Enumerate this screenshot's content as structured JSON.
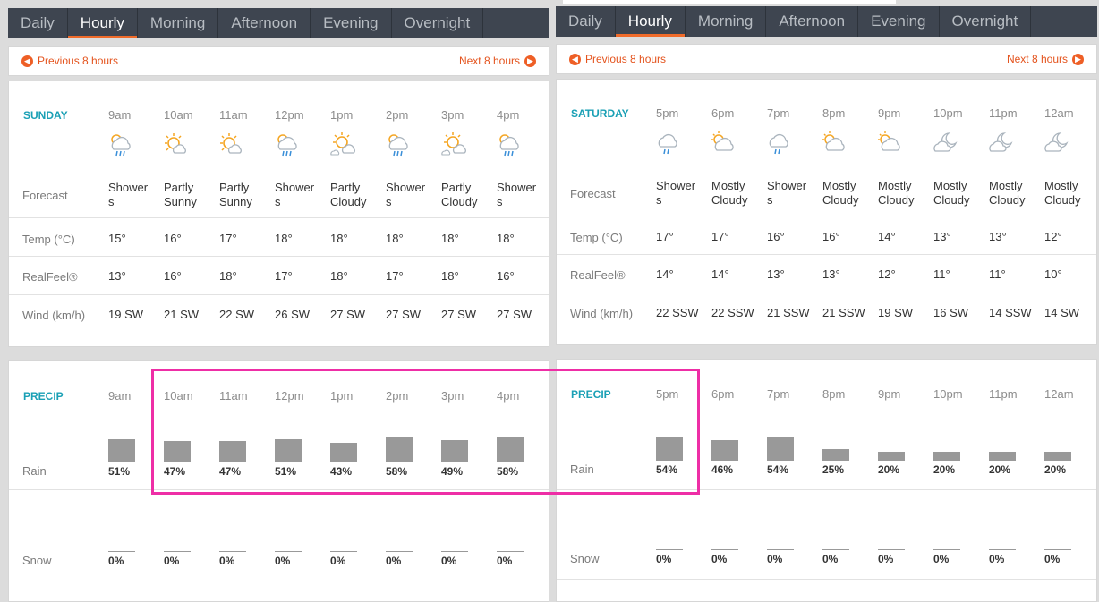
{
  "tabs": [
    "Daily",
    "Hourly",
    "Morning",
    "Afternoon",
    "Evening",
    "Overnight"
  ],
  "active_tab": "Hourly",
  "nav": {
    "prev": "Previous 8 hours",
    "next": "Next 8 hours"
  },
  "labels": {
    "forecast": "Forecast",
    "temp": "Temp (°C)",
    "realfeel": "RealFeel®",
    "wind": "Wind (km/h)",
    "precip": "PRECIP",
    "rain": "Rain",
    "snow": "Snow"
  },
  "colors": {
    "accent": "#f06b2a",
    "day_label": "#1aa0b5",
    "tab_bg": "#3e4550",
    "bar": "#999999",
    "highlight": "#ee2ea6"
  },
  "panels": [
    {
      "day": "SUNDAY",
      "hours": [
        "9am",
        "10am",
        "11am",
        "12pm",
        "1pm",
        "2pm",
        "3pm",
        "4pm"
      ],
      "icons": [
        "cloud-rain-sun-icon",
        "partly-sunny-icon",
        "partly-sunny-icon",
        "cloud-rain-sun-icon",
        "partly-cloudy-icon",
        "cloud-rain-sun-icon",
        "partly-cloudy-icon",
        "cloud-rain-sun-icon"
      ],
      "forecast_l1": [
        "Shower",
        "Partly",
        "Partly",
        "Shower",
        "Partly",
        "Shower",
        "Partly",
        "Shower"
      ],
      "forecast_l2": [
        "s",
        "Sunny",
        "Sunny",
        "s",
        "Cloudy",
        "s",
        "Cloudy",
        "s"
      ],
      "temp": [
        "15°",
        "16°",
        "17°",
        "18°",
        "18°",
        "18°",
        "18°",
        "18°"
      ],
      "realfeel": [
        "13°",
        "16°",
        "18°",
        "17°",
        "18°",
        "17°",
        "18°",
        "16°"
      ],
      "wind": [
        "19 SW",
        "21 SW",
        "22 SW",
        "26 SW",
        "27 SW",
        "27 SW",
        "27 SW",
        "27 SW"
      ],
      "rain_pct": [
        51,
        47,
        47,
        51,
        43,
        58,
        49,
        58
      ],
      "rain": [
        "51%",
        "47%",
        "47%",
        "51%",
        "43%",
        "58%",
        "49%",
        "58%"
      ],
      "snow": [
        "0%",
        "0%",
        "0%",
        "0%",
        "0%",
        "0%",
        "0%",
        "0%"
      ]
    },
    {
      "day": "SATURDAY",
      "hours": [
        "5pm",
        "6pm",
        "7pm",
        "8pm",
        "9pm",
        "10pm",
        "11pm",
        "12am"
      ],
      "icons": [
        "cloud-rain-icon",
        "mostly-cloudy-sun-icon",
        "cloud-rain-icon",
        "mostly-cloudy-sun-icon",
        "mostly-cloudy-sun-icon",
        "cloudy-moon-icon",
        "cloudy-moon-icon",
        "cloudy-moon-icon"
      ],
      "forecast_l1": [
        "Shower",
        "Mostly",
        "Shower",
        "Mostly",
        "Mostly",
        "Mostly",
        "Mostly",
        "Mostly"
      ],
      "forecast_l2": [
        "s",
        "Cloudy",
        "s",
        "Cloudy",
        "Cloudy",
        "Cloudy",
        "Cloudy",
        "Cloudy"
      ],
      "temp": [
        "17°",
        "17°",
        "16°",
        "16°",
        "14°",
        "13°",
        "13°",
        "12°"
      ],
      "realfeel": [
        "14°",
        "14°",
        "13°",
        "13°",
        "12°",
        "11°",
        "11°",
        "10°"
      ],
      "wind": [
        "22 SSW",
        "22 SSW",
        "21 SSW",
        "21 SSW",
        "19 SW",
        "16 SW",
        "14 SSW",
        "14 SW"
      ],
      "rain_pct": [
        54,
        46,
        54,
        25,
        20,
        20,
        20,
        20
      ],
      "rain": [
        "54%",
        "46%",
        "54%",
        "25%",
        "20%",
        "20%",
        "20%",
        "20%"
      ],
      "snow": [
        "0%",
        "0%",
        "0%",
        "0%",
        "0%",
        "0%",
        "0%",
        "0%"
      ]
    }
  ]
}
